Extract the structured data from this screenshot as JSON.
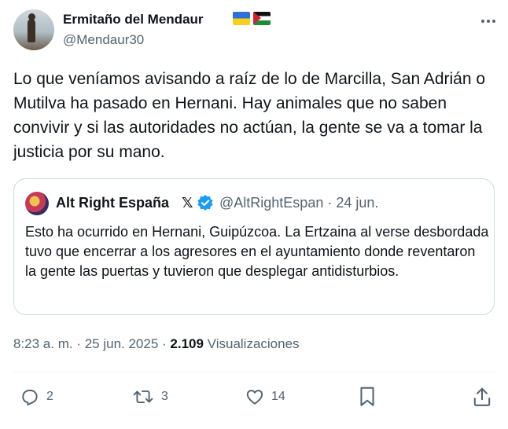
{
  "author": {
    "display_name": "Ermitaño del Mendaur",
    "handle": "@Mendaur30",
    "flags": [
      "ukraine-flag",
      "palestine-flag"
    ]
  },
  "tweet": {
    "text": "Lo que veníamos avisando a raíz de lo de Marcilla, San Adrián o Mutilva ha pasado en Hernani. Hay animales que no saben convivir y si las autoridades no actúan, la gente se va a tomar la justicia por su mano."
  },
  "quote": {
    "display_name": "Alt Right España",
    "badge_x": "𝕏",
    "handle_date": "@AltRightEspan · 24 jun.",
    "text": "Esto ha ocurrido en Hernani, Guipúzcoa. La Ertzaina al verse desbordada tuvo que encerrar a los agresores en el ayuntamiento donde reventaron la gente las puertas y tuvieron que desplegar antidisturbios."
  },
  "meta": {
    "time_date": "8:23 a. m. · 25 jun. 2025 · ",
    "views_count": "2.109",
    "views_label": " Visualizaciones"
  },
  "actions": {
    "replies": "2",
    "retweets": "3",
    "likes": "14"
  },
  "colors": {
    "verified": "#1d9bf0",
    "muted": "#536471",
    "text": "#0f1419",
    "border": "#cfd9de"
  }
}
